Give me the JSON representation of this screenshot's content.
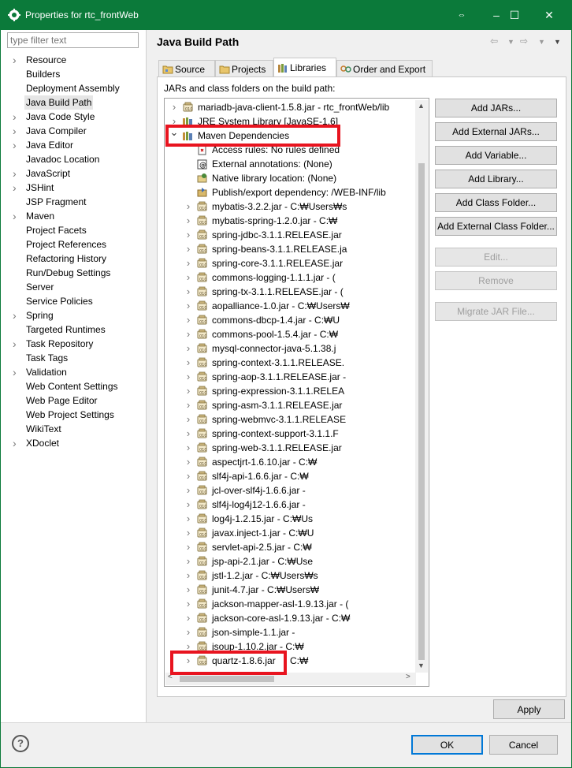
{
  "window": {
    "title": "Properties for rtc_frontWeb",
    "minimize_glyph": "–",
    "maximize_glyph": "☐",
    "close_glyph": "✕",
    "restore_glyph": "⇔"
  },
  "filter": {
    "placeholder": "type filter text"
  },
  "nav": [
    {
      "label": "Resource",
      "expandable": true
    },
    {
      "label": "Builders",
      "expandable": false
    },
    {
      "label": "Deployment Assembly",
      "expandable": false
    },
    {
      "label": "Java Build Path",
      "expandable": false,
      "selected": true
    },
    {
      "label": "Java Code Style",
      "expandable": true
    },
    {
      "label": "Java Compiler",
      "expandable": true
    },
    {
      "label": "Java Editor",
      "expandable": true
    },
    {
      "label": "Javadoc Location",
      "expandable": false
    },
    {
      "label": "JavaScript",
      "expandable": true
    },
    {
      "label": "JSHint",
      "expandable": true
    },
    {
      "label": "JSP Fragment",
      "expandable": false
    },
    {
      "label": "Maven",
      "expandable": true
    },
    {
      "label": "Project Facets",
      "expandable": false
    },
    {
      "label": "Project References",
      "expandable": false
    },
    {
      "label": "Refactoring History",
      "expandable": false
    },
    {
      "label": "Run/Debug Settings",
      "expandable": false
    },
    {
      "label": "Server",
      "expandable": false
    },
    {
      "label": "Service Policies",
      "expandable": false
    },
    {
      "label": "Spring",
      "expandable": true
    },
    {
      "label": "Targeted Runtimes",
      "expandable": false
    },
    {
      "label": "Task Repository",
      "expandable": true
    },
    {
      "label": "Task Tags",
      "expandable": false
    },
    {
      "label": "Validation",
      "expandable": true
    },
    {
      "label": "Web Content Settings",
      "expandable": false
    },
    {
      "label": "Web Page Editor",
      "expandable": false
    },
    {
      "label": "Web Project Settings",
      "expandable": false
    },
    {
      "label": "WikiText",
      "expandable": false
    },
    {
      "label": "XDoclet",
      "expandable": true
    }
  ],
  "page": {
    "title": "Java Build Path"
  },
  "tabs": [
    {
      "label": "Source",
      "icon": "source-folder-icon"
    },
    {
      "label": "Projects",
      "icon": "projects-icon"
    },
    {
      "label": "Libraries",
      "icon": "libraries-icon",
      "active": true
    },
    {
      "label": "Order and Export",
      "icon": "order-export-icon"
    }
  ],
  "libraries": {
    "caption": "JARs and class folders on the build path:",
    "tree": [
      {
        "text": "mariadb-java-client-1.5.8.jar - rtc_frontWeb/lib",
        "level": 0,
        "expander": "collapsed",
        "icon": "jar"
      },
      {
        "text": "JRE System Library [JavaSE-1.6]",
        "level": 0,
        "expander": "collapsed",
        "icon": "library"
      },
      {
        "text": "Maven Dependencies",
        "level": 0,
        "expander": "expanded",
        "icon": "library",
        "selected": true
      },
      {
        "text": "Access rules: No rules defined",
        "level": 1,
        "expander": "none",
        "icon": "rules"
      },
      {
        "text": "External annotations: (None)",
        "level": 1,
        "expander": "none",
        "icon": "annotation"
      },
      {
        "text": "Native library location: (None)",
        "level": 1,
        "expander": "none",
        "icon": "native"
      },
      {
        "text": "Publish/export dependency: /WEB-INF/lib",
        "level": 1,
        "expander": "none",
        "icon": "publish"
      },
      {
        "text": "mybatis-3.2.2.jar - C:₩Users₩s",
        "level": 1,
        "expander": "collapsed",
        "icon": "jar"
      },
      {
        "text": "mybatis-spring-1.2.0.jar - C:₩",
        "level": 1,
        "expander": "collapsed",
        "icon": "jar"
      },
      {
        "text": "spring-jdbc-3.1.1.RELEASE.jar",
        "level": 1,
        "expander": "collapsed",
        "icon": "jar"
      },
      {
        "text": "spring-beans-3.1.1.RELEASE.ja",
        "level": 1,
        "expander": "collapsed",
        "icon": "jar"
      },
      {
        "text": "spring-core-3.1.1.RELEASE.jar",
        "level": 1,
        "expander": "collapsed",
        "icon": "jar"
      },
      {
        "text": "commons-logging-1.1.1.jar - (",
        "level": 1,
        "expander": "collapsed",
        "icon": "jar"
      },
      {
        "text": "spring-tx-3.1.1.RELEASE.jar - (",
        "level": 1,
        "expander": "collapsed",
        "icon": "jar"
      },
      {
        "text": "aopalliance-1.0.jar - C:₩Users₩",
        "level": 1,
        "expander": "collapsed",
        "icon": "jar"
      },
      {
        "text": "commons-dbcp-1.4.jar - C:₩U",
        "level": 1,
        "expander": "collapsed",
        "icon": "jar"
      },
      {
        "text": "commons-pool-1.5.4.jar - C:₩",
        "level": 1,
        "expander": "collapsed",
        "icon": "jar"
      },
      {
        "text": "mysql-connector-java-5.1.38.j",
        "level": 1,
        "expander": "collapsed",
        "icon": "jar"
      },
      {
        "text": "spring-context-3.1.1.RELEASE.",
        "level": 1,
        "expander": "collapsed",
        "icon": "jar"
      },
      {
        "text": "spring-aop-3.1.1.RELEASE.jar -",
        "level": 1,
        "expander": "collapsed",
        "icon": "jar"
      },
      {
        "text": "spring-expression-3.1.1.RELEA",
        "level": 1,
        "expander": "collapsed",
        "icon": "jar"
      },
      {
        "text": "spring-asm-3.1.1.RELEASE.jar",
        "level": 1,
        "expander": "collapsed",
        "icon": "jar"
      },
      {
        "text": "spring-webmvc-3.1.1.RELEASE",
        "level": 1,
        "expander": "collapsed",
        "icon": "jar"
      },
      {
        "text": "spring-context-support-3.1.1.F",
        "level": 1,
        "expander": "collapsed",
        "icon": "jar"
      },
      {
        "text": "spring-web-3.1.1.RELEASE.jar",
        "level": 1,
        "expander": "collapsed",
        "icon": "jar"
      },
      {
        "text": "aspectjrt-1.6.10.jar - C:₩",
        "level": 1,
        "expander": "collapsed",
        "icon": "jar"
      },
      {
        "text": "slf4j-api-1.6.6.jar - C:₩",
        "level": 1,
        "expander": "collapsed",
        "icon": "jar"
      },
      {
        "text": "jcl-over-slf4j-1.6.6.jar -",
        "level": 1,
        "expander": "collapsed",
        "icon": "jar"
      },
      {
        "text": "slf4j-log4j12-1.6.6.jar -",
        "level": 1,
        "expander": "collapsed",
        "icon": "jar"
      },
      {
        "text": "log4j-1.2.15.jar - C:₩Us",
        "level": 1,
        "expander": "collapsed",
        "icon": "jar"
      },
      {
        "text": "javax.inject-1.jar - C:₩U",
        "level": 1,
        "expander": "collapsed",
        "icon": "jar"
      },
      {
        "text": "servlet-api-2.5.jar - C:₩",
        "level": 1,
        "expander": "collapsed",
        "icon": "jar"
      },
      {
        "text": "jsp-api-2.1.jar - C:₩Use",
        "level": 1,
        "expander": "collapsed",
        "icon": "jar"
      },
      {
        "text": "jstl-1.2.jar - C:₩Users₩s",
        "level": 1,
        "expander": "collapsed",
        "icon": "jar"
      },
      {
        "text": "junit-4.7.jar - C:₩Users₩",
        "level": 1,
        "expander": "collapsed",
        "icon": "jar"
      },
      {
        "text": "jackson-mapper-asl-1.9.13.jar - (",
        "level": 1,
        "expander": "collapsed",
        "icon": "jar"
      },
      {
        "text": "jackson-core-asl-1.9.13.jar - C:₩",
        "level": 1,
        "expander": "collapsed",
        "icon": "jar"
      },
      {
        "text": "json-simple-1.1.jar -",
        "level": 1,
        "expander": "collapsed",
        "icon": "jar"
      },
      {
        "text": "jsoup-1.10.2.jar - C:₩",
        "level": 1,
        "expander": "collapsed",
        "icon": "jar"
      },
      {
        "text": "quartz-1.8.6.jar",
        "level": 1,
        "expander": "collapsed",
        "icon": "jar",
        "suffix": "C:₩"
      }
    ]
  },
  "buttons": [
    {
      "name": "add-jars-button",
      "label": "Add JARs...",
      "enabled": true
    },
    {
      "name": "add-external-jars-button",
      "label": "Add External JARs...",
      "enabled": true
    },
    {
      "name": "add-variable-button",
      "label": "Add Variable...",
      "enabled": true
    },
    {
      "name": "add-library-button",
      "label": "Add Library...",
      "enabled": true
    },
    {
      "name": "add-class-folder-button",
      "label": "Add Class Folder...",
      "enabled": true
    },
    {
      "name": "add-external-class-folder-button",
      "label": "Add External Class Folder...",
      "enabled": true
    },
    {
      "name": "edit-button",
      "label": "Edit...",
      "enabled": false
    },
    {
      "name": "remove-button",
      "label": "Remove",
      "enabled": false
    },
    {
      "name": "migrate-jar-file-button",
      "label": "Migrate JAR File...",
      "enabled": false
    }
  ],
  "footer": {
    "apply": "Apply",
    "ok": "OK",
    "cancel": "Cancel",
    "help_glyph": "?"
  },
  "colors": {
    "titlebar": "#0b7a3a",
    "highlight": "#e8141f",
    "default_button_border": "#0078d7"
  }
}
